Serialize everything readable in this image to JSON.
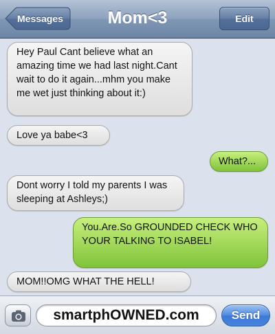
{
  "navbar": {
    "back_label": "Messages",
    "title": "Mom<3",
    "edit_label": "Edit"
  },
  "messages": [
    {
      "direction": "incoming",
      "text": "Hey Paul Cant believe what an amazing time we had last night.Cant wait to do it again...mhm you make me wet just thinking about it:)"
    },
    {
      "direction": "incoming",
      "text": "Love ya babe<3"
    },
    {
      "direction": "outgoing",
      "text": "What?..."
    },
    {
      "direction": "incoming",
      "text": "Dont worry I told my parents I was sleeping at Ashleys;)"
    },
    {
      "direction": "outgoing",
      "text": "You.Are.So GROUNDED CHECK WHO YOUR TALKING TO ISABEL!"
    },
    {
      "direction": "incoming",
      "text": "MOM!!OMG WHAT THE HELL!"
    }
  ],
  "input": {
    "camera_icon": "camera-icon",
    "value": "smartphOWNED.com",
    "send_label": "Send"
  },
  "colors": {
    "incoming_bubble": "#e6e6e6",
    "outgoing_bubble": "#9ed95a",
    "navbar": "#7f96b4",
    "send_button": "#3c79d6",
    "background": "#dbe2ed"
  }
}
